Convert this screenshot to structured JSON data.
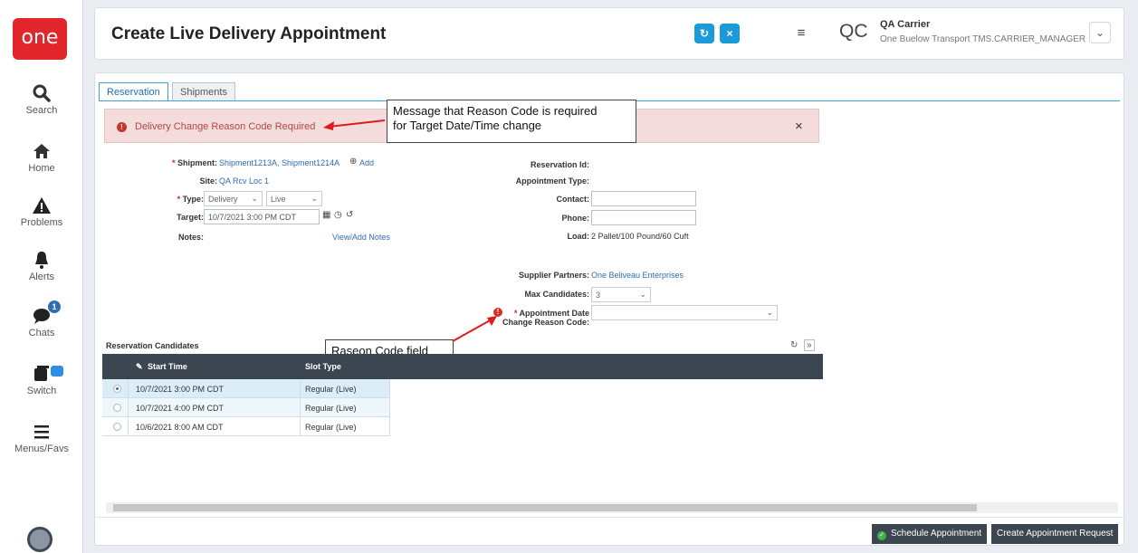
{
  "app": {
    "logo_text": "one"
  },
  "nav": {
    "items": [
      {
        "label": "Search",
        "icon": "search-icon"
      },
      {
        "label": "Home",
        "icon": "home-icon"
      },
      {
        "label": "Problems",
        "icon": "warning-icon"
      },
      {
        "label": "Alerts",
        "icon": "bell-icon"
      },
      {
        "label": "Chats",
        "icon": "chat-icon",
        "badge": "1"
      },
      {
        "label": "Switch",
        "icon": "switch-icon"
      },
      {
        "label": "Menus/Favs",
        "icon": "menu-icon"
      }
    ]
  },
  "header": {
    "title": "Create Live Delivery Appointment",
    "refresh_icon": "refresh-icon",
    "close_icon": "close-icon",
    "menu_icon": "hamburger-icon",
    "user_initials": "QC",
    "user_name": "QA Carrier",
    "user_role": "One Buelow Transport TMS.CARRIER_MANAGER",
    "accent_color": "#1a9ad6"
  },
  "tabs": [
    {
      "label": "Reservation",
      "active": true
    },
    {
      "label": "Shipments",
      "active": false
    }
  ],
  "error": {
    "message": "Delivery Change Reason Code Required",
    "close": "×",
    "color": "#b34545"
  },
  "callouts": {
    "message": "Message that Reason Code is required\nfor Target Date/Time change",
    "field": "Raseon Code field"
  },
  "form_left": {
    "shipment_label": "Shipment:",
    "shipment_value": "Shipment1213A, Shipment1214A",
    "shipment_add": "Add",
    "site_label": "Site:",
    "site_value": "QA Rcv Loc 1",
    "type_label": "Type:",
    "type_value": "Delivery",
    "mode_value": "Live",
    "target_label": "Target:",
    "target_value": "10/7/2021 3:00 PM CDT",
    "notes_label": "Notes:",
    "notes_link": "View/Add Notes"
  },
  "form_right": {
    "reservation_id_label": "Reservation Id:",
    "appointment_type_label": "Appointment Type:",
    "contact_label": "Contact:",
    "phone_label": "Phone:",
    "load_label": "Load:",
    "load_value": "2 Pallet/100 Pound/60 Cuft",
    "supplier_label": "Supplier Partners:",
    "supplier_value": "One Beliveau Enterprises",
    "max_candidates_label": "Max Candidates:",
    "max_candidates_value": "3",
    "reason_label_1": "Appointment Date",
    "reason_label_2": "Change Reason Code:",
    "reason_value": ""
  },
  "candidates": {
    "title": "Reservation Candidates",
    "columns": [
      "Start Time",
      "Slot Type"
    ],
    "rows": [
      {
        "start": "10/7/2021 3:00 PM CDT",
        "slot": "Regular (Live)",
        "selected": true
      },
      {
        "start": "10/7/2021 4:00 PM CDT",
        "slot": "Regular (Live)",
        "selected": false
      },
      {
        "start": "10/6/2021 8:00 AM CDT",
        "slot": "Regular (Live)",
        "selected": false
      }
    ]
  },
  "footer": {
    "schedule_label": "Schedule Appointment",
    "request_label": "Create Appointment Request"
  }
}
